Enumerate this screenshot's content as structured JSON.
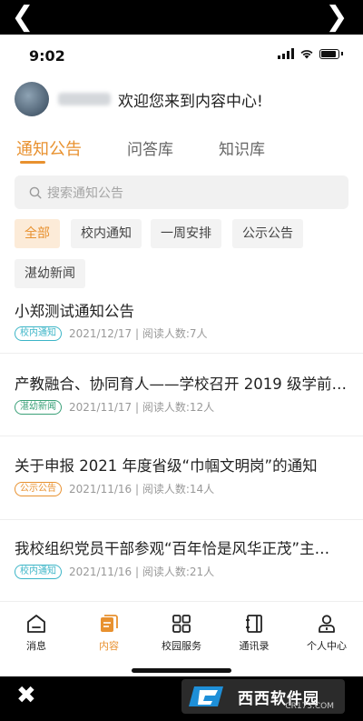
{
  "status": {
    "time": "9:02"
  },
  "profile": {
    "welcome": "欢迎您来到内容中心!"
  },
  "tabs": [
    {
      "label": "通知公告",
      "active": true
    },
    {
      "label": "问答库",
      "active": false
    },
    {
      "label": "知识库",
      "active": false
    }
  ],
  "search": {
    "placeholder": "搜索通知公告"
  },
  "filters": [
    {
      "label": "全部",
      "active": true
    },
    {
      "label": "校内通知",
      "active": false
    },
    {
      "label": "一周安排",
      "active": false
    },
    {
      "label": "公示公告",
      "active": false
    },
    {
      "label": "湛幼新闻",
      "active": false
    }
  ],
  "articles": [
    {
      "title": "小郑测试通知公告",
      "tag": "校内通知",
      "tag_color": "#3cb5c7",
      "meta": "2021/12/17 | 阅读人数:7人"
    },
    {
      "title": "产教融合、协同育人——学校召开 2019 级学前…",
      "tag": "湛幼新闻",
      "tag_color": "#3aa078",
      "meta": "2021/11/17 | 阅读人数:12人"
    },
    {
      "title": "关于申报 2021 年度省级“巾帼文明岗”的通知",
      "tag": "公示公告",
      "tag_color": "#e8912f",
      "meta": "2021/11/16 | 阅读人数:14人"
    },
    {
      "title": "我校组织党员干部参观“百年恰是风华正茂”主…",
      "tag": "校内通知",
      "tag_color": "#3cb5c7",
      "meta": "2021/11/16 | 阅读人数:21人"
    }
  ],
  "tabbar": [
    {
      "label": "消息",
      "icon": "message-icon",
      "active": false
    },
    {
      "label": "内容",
      "icon": "content-icon",
      "active": true
    },
    {
      "label": "校园服务",
      "icon": "grid-icon",
      "active": false
    },
    {
      "label": "通讯录",
      "icon": "contacts-icon",
      "active": false
    },
    {
      "label": "个人中心",
      "icon": "user-icon",
      "active": false
    }
  ],
  "watermark": {
    "text": "西西软件园",
    "sub": "CR173.COM"
  },
  "colors": {
    "accent": "#e8912f"
  }
}
